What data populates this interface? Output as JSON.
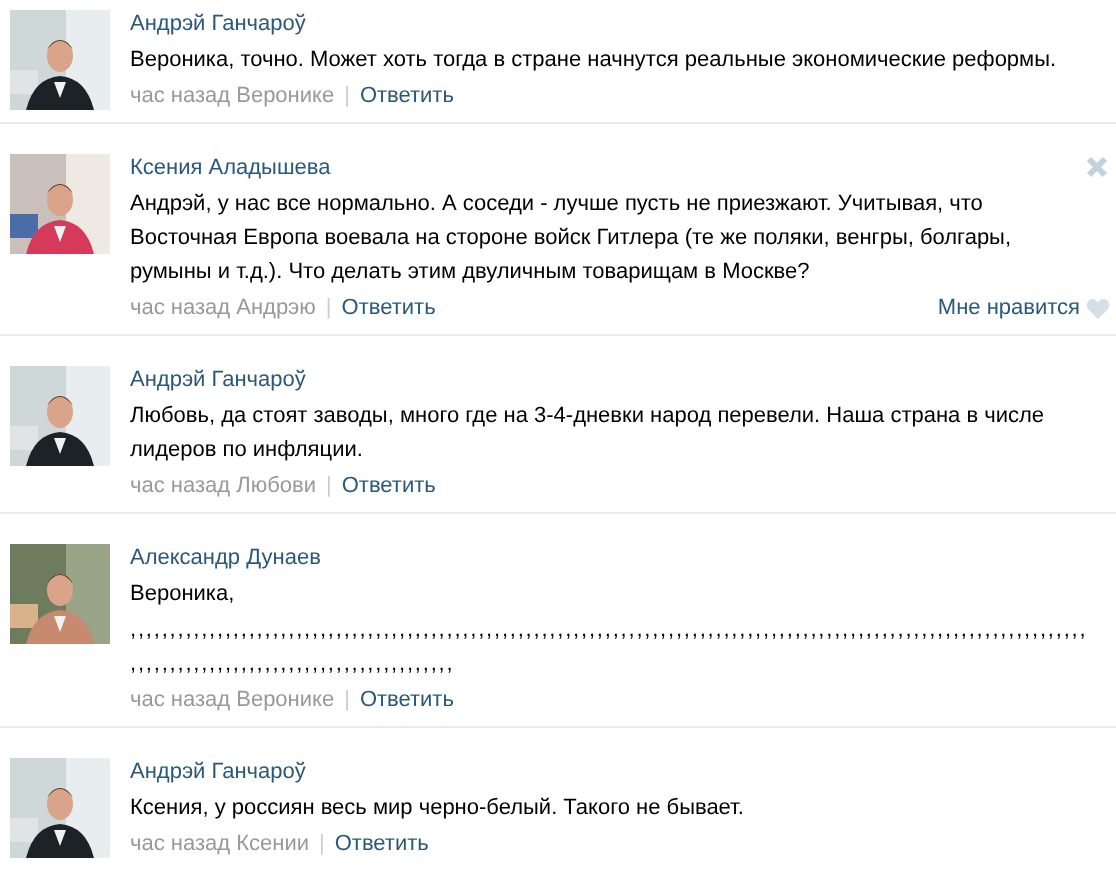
{
  "comments": [
    {
      "author": "Андрэй Ганчароў",
      "text": "Вероника, точно. Может хоть тогда в стране начнутся реальные экономические реформы.",
      "meta": "час назад Веронике",
      "separator": "|",
      "reply": "Ответить",
      "hovered": false
    },
    {
      "author": "Ксения Аладышева",
      "text": "Андрэй, у нас все нормально. А соседи - лучше пусть не приезжают. Учитывая, что Восточная Европа воевала на стороне войск Гитлера (те же поляки, венгры, болгары, румыны и т.д.). Что делать этим двуличным товарищам в Москве?",
      "meta": "час назад Андрэю",
      "separator": "|",
      "reply": "Ответить",
      "like_label": "Мне нравится",
      "hovered": true
    },
    {
      "author": "Андрэй Ганчароў",
      "text": "Любовь, да стоят заводы, много где на 3-4-дневки народ перевели. Наша страна в числе лидеров по инфляции.",
      "meta": "час назад Любови",
      "separator": "|",
      "reply": "Ответить",
      "hovered": false
    },
    {
      "author": "Александр Дунаев",
      "text": "Вероника,",
      "text_2": ",,,,,,,,,,,,,,,,,,,,,,,,,,,,,,,,,,,,,,,,,,,,,,,,,,,,,,,,,,,,,,,,,,,,,,,,,,,,,,,,,,,,,,,,,,,,,,,,,,,,,,,,,,,,,,,,,,,,,,,,,,,,,,,,,,,,,,,,,,,,,,,,,,,,,,,,,,,,,,,,,,",
      "meta": "час назад Веронике",
      "separator": "|",
      "reply": "Ответить",
      "hovered": false
    },
    {
      "author": "Андрэй Ганчароў",
      "text": "Ксения, у россиян весь мир черно-белый. Такого не бывает.",
      "meta": "час назад Ксении",
      "separator": "|",
      "reply": "Ответить",
      "hovered": false
    }
  ]
}
